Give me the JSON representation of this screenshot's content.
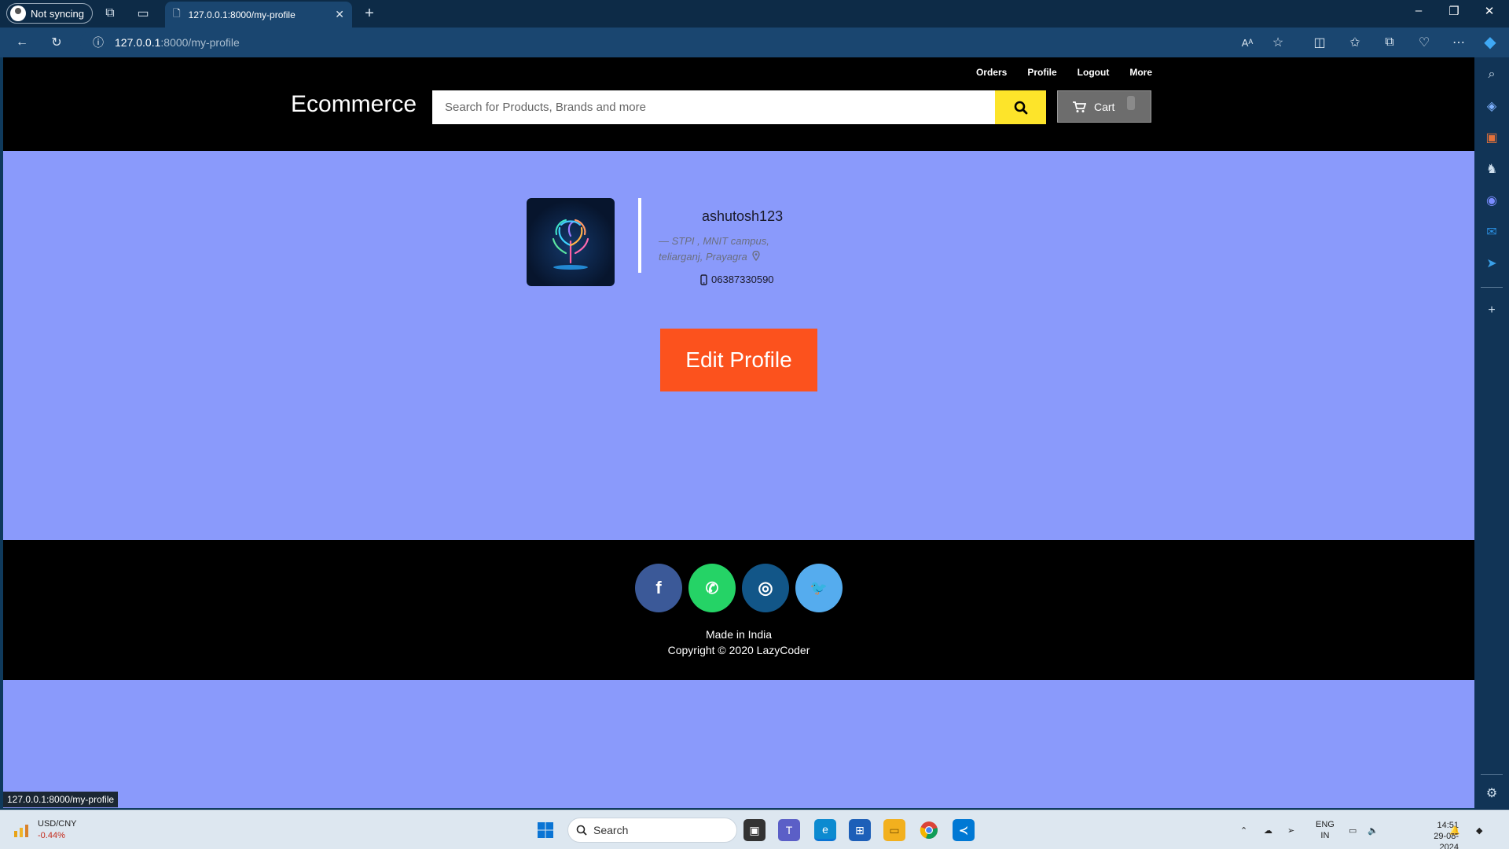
{
  "browser": {
    "profile_label": "Not syncing",
    "tab_title": "127.0.0.1:8000/my-profile",
    "url_host": "127.0.0.1",
    "url_path": ":8000/my-profile",
    "status_url": "127.0.0.1:8000/my-profile"
  },
  "header": {
    "links": [
      "Orders",
      "Profile",
      "Logout",
      "More"
    ],
    "brand": "Ecommerce",
    "search_placeholder": "Search for Products, Brands and more",
    "cart_label": "Cart"
  },
  "profile": {
    "username": "ashutosh123",
    "address_line1": "— STPI , MNIT campus,",
    "address_line2": "teliarganj, Prayagra",
    "phone": "06387330590",
    "edit_label": "Edit Profile"
  },
  "footer": {
    "socials": [
      {
        "name": "facebook",
        "glyph": "f",
        "color": "#3b5998"
      },
      {
        "name": "whatsapp",
        "glyph": "✆",
        "color": "#25d366"
      },
      {
        "name": "instagram",
        "glyph": "◎",
        "color": "#125688"
      },
      {
        "name": "twitter",
        "glyph": "🐦",
        "color": "#55acee"
      }
    ],
    "made_in": "Made in India",
    "copyright": "Copyright © 2020 LazyCoder"
  },
  "taskbar": {
    "widget_title": "USD/CNY",
    "widget_value": "-0.44%",
    "search_label": "Search",
    "lang_line1": "ENG",
    "lang_line2": "IN",
    "time": "14:51",
    "date": "29-08-2024"
  },
  "colors": {
    "page_bg": "#8a9afb",
    "header_bg": "#000000",
    "search_button": "#fde42a",
    "edit_button": "#fc521d"
  }
}
